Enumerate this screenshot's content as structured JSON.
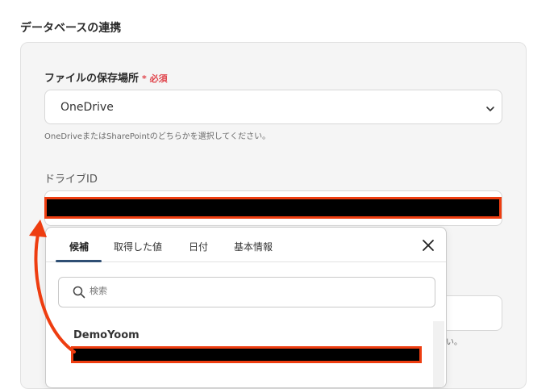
{
  "section": {
    "title": "データベースの連携"
  },
  "storage_field": {
    "label": "ファイルの保存場所",
    "required_label": "* 必須",
    "selected_value": "OneDrive",
    "help_text": "OneDriveまたはSharePointのどちらかを選択してください。"
  },
  "drive_field": {
    "label": "ドライブID",
    "value": ""
  },
  "popup": {
    "tabs": [
      {
        "label": "候補",
        "active": true
      },
      {
        "label": "取得した値",
        "active": false
      },
      {
        "label": "日付",
        "active": false
      },
      {
        "label": "基本情報",
        "active": false
      }
    ],
    "search_placeholder": "検索",
    "list_title": "DemoYoom"
  },
  "partial_help_suffix": "い。",
  "colors": {
    "accent_red": "#ee3d10",
    "required_red": "#e0454c",
    "tab_underline": "#2f4f74"
  },
  "icons": {
    "select": "chevron-down-icon",
    "close": "close-icon",
    "search": "search-icon"
  }
}
